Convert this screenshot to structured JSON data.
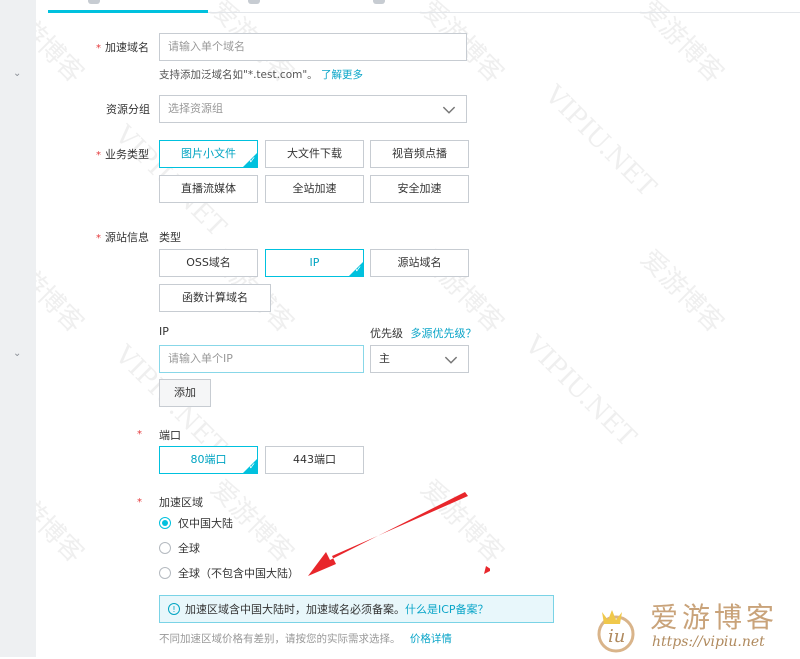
{
  "form": {
    "domain": {
      "label": "加速域名",
      "placeholder": "请输入单个域名",
      "hint": "支持添加泛域名如\"*.test.com\"。",
      "hint_link": "了解更多"
    },
    "group": {
      "label": "资源分组",
      "placeholder": "选择资源组"
    },
    "biz_type": {
      "label": "业务类型",
      "options": [
        "图片小文件",
        "大文件下载",
        "视音频点播",
        "直播流媒体",
        "全站加速",
        "安全加速"
      ],
      "selected": "图片小文件"
    },
    "origin": {
      "label": "源站信息",
      "type_label": "类型",
      "types": [
        "OSS域名",
        "IP",
        "源站域名",
        "函数计算域名"
      ],
      "selected": "IP",
      "ip_label": "IP",
      "ip_placeholder": "请输入单个IP",
      "priority_label": "优先级",
      "priority_link": "多源优先级？",
      "priority_value": "主",
      "add_button": "添加"
    },
    "port": {
      "label": "端口",
      "options": [
        "80端口",
        "443端口"
      ],
      "selected": "80端口"
    },
    "region": {
      "label": "加速区域",
      "options": [
        "仅中国大陆",
        "全球",
        "全球（不包含中国大陆）"
      ],
      "selected": "仅中国大陆",
      "notice": "加速区域含中国大陆时，加速域名必须备案。",
      "notice_link": "什么是ICP备案？",
      "footer": "不同加速区域价格有差别，请按您的实际需求选择。",
      "footer_link": "价格详情"
    }
  },
  "watermark": {
    "cn": "爱游博客",
    "en": "VIPIU.NET"
  },
  "logo": {
    "text": "爱游博客",
    "url": "https://vipiu.net"
  },
  "colors": {
    "accent": "#00c1de",
    "link": "#0aa5c8",
    "required": "#e4393c",
    "arrow": "#e8262b"
  }
}
